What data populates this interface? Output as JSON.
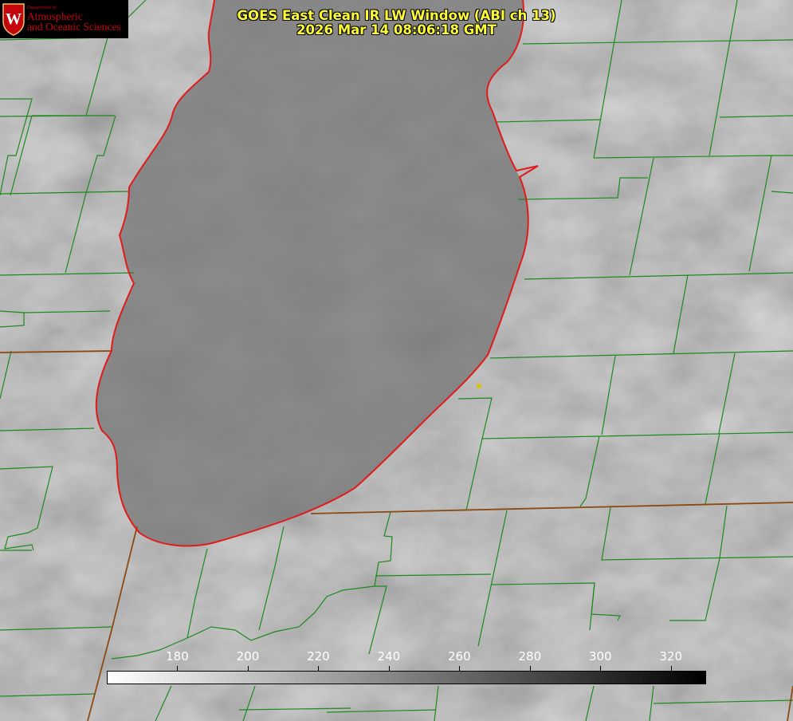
{
  "title": {
    "line1": "GOES East Clean IR LW Window (ABI ch 13)",
    "line2": "2026 Mar 14 08:06:18 GMT"
  },
  "logo": {
    "dept": "Department of",
    "line1": "Atmospheric",
    "line2": "and Oceanic Sciences",
    "crest_letter": "W"
  },
  "colorbar": {
    "min": 160,
    "max": 330,
    "ticks": [
      "180",
      "200",
      "220",
      "240",
      "260",
      "280",
      "300",
      "320"
    ],
    "color_low": "#ffffff",
    "color_high": "#000000"
  },
  "colors": {
    "coastline": "#e11a1a",
    "county_lines": "#1d8a1d",
    "state_lines": "#8b4a12",
    "marker": "#d4c400",
    "title": "#ffff33",
    "logo_red": "#c5050c"
  }
}
